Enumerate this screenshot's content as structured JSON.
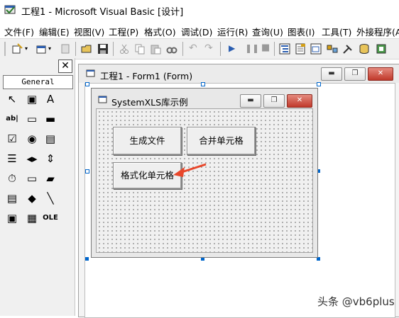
{
  "app": {
    "title": "工程1 - Microsoft Visual Basic [设计]"
  },
  "menu": [
    {
      "label": "文件(F)"
    },
    {
      "label": "编辑(E)"
    },
    {
      "label": "视图(V)"
    },
    {
      "label": "工程(P)"
    },
    {
      "label": "格式(O)"
    },
    {
      "label": "调试(D)"
    },
    {
      "label": "运行(R)"
    },
    {
      "label": "查询(U)"
    },
    {
      "label": "图表(I)"
    },
    {
      "label": "工具(T)"
    },
    {
      "label": "外接程序(A)"
    }
  ],
  "toolbar": {
    "icons": [
      "add-project-icon",
      "add-form-icon",
      "menu-editor-icon",
      "open-icon",
      "save-icon",
      "cut-icon",
      "copy-icon",
      "paste-icon",
      "find-icon",
      "undo-icon",
      "redo-icon",
      "start-icon",
      "break-icon",
      "end-icon",
      "project-explorer-icon",
      "properties-icon",
      "form-layout-icon",
      "object-browser-icon",
      "toolbox-icon",
      "data-view-icon",
      "component-manager-icon"
    ]
  },
  "toolbox": {
    "tab_label": "General",
    "close_glyph": "✕",
    "tools": [
      {
        "name": "pointer-tool-icon",
        "glyph": "↖"
      },
      {
        "name": "picturebox-tool-icon",
        "glyph": "▣"
      },
      {
        "name": "label-tool-icon",
        "glyph": "A"
      },
      {
        "name": "textbox-tool-icon",
        "glyph": "ab|"
      },
      {
        "name": "frame-tool-icon",
        "glyph": "▭"
      },
      {
        "name": "commandbutton-tool-icon",
        "glyph": "▬"
      },
      {
        "name": "checkbox-tool-icon",
        "glyph": "☑"
      },
      {
        "name": "optionbutton-tool-icon",
        "glyph": "◉"
      },
      {
        "name": "combobox-tool-icon",
        "glyph": "▤"
      },
      {
        "name": "listbox-tool-icon",
        "glyph": "☰"
      },
      {
        "name": "hscrollbar-tool-icon",
        "glyph": "◂▸"
      },
      {
        "name": "vscrollbar-tool-icon",
        "glyph": "⇕"
      },
      {
        "name": "timer-tool-icon",
        "glyph": "⏱"
      },
      {
        "name": "drivelistbox-tool-icon",
        "glyph": "▭"
      },
      {
        "name": "dirlistbox-tool-icon",
        "glyph": "▰"
      },
      {
        "name": "filelistbox-tool-icon",
        "glyph": "▤"
      },
      {
        "name": "shape-tool-icon",
        "glyph": "◆"
      },
      {
        "name": "line-tool-icon",
        "glyph": "╲"
      },
      {
        "name": "image-tool-icon",
        "glyph": "▣"
      },
      {
        "name": "data-tool-icon",
        "glyph": "▦"
      },
      {
        "name": "ole-tool-icon",
        "glyph": "OLE"
      }
    ]
  },
  "project_window": {
    "title": "工程1 - Form1 (Form)",
    "min_glyph": "▬",
    "max_glyph": "❐",
    "close_glyph": "✕"
  },
  "form": {
    "caption": "SystemXLS库示例",
    "min_glyph": "▬",
    "max_glyph": "❐",
    "close_glyph": "✕",
    "buttons": {
      "generate": "生成文件",
      "merge": "合并单元格",
      "format": "格式化单元格"
    }
  },
  "colors": {
    "arrow": "#e8472b",
    "selection_handle": "#0066cc",
    "close_button": "#c0392b"
  },
  "watermark": "头条 @vb6plus"
}
